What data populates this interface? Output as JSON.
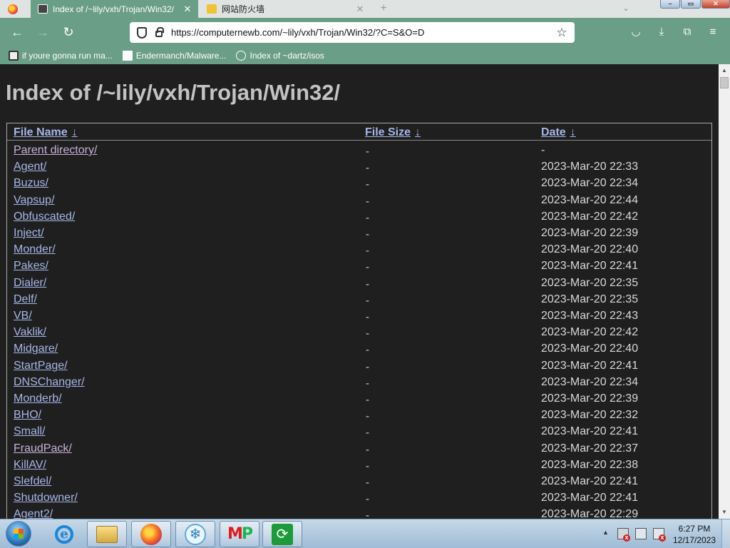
{
  "browser": {
    "tabs": [
      {
        "title": "Index of /~lily/vxh/Trojan/Win32/",
        "active": true,
        "close": "✕"
      },
      {
        "title": "网站防火墙",
        "active": false,
        "close": "✕"
      }
    ],
    "new_tab": "+",
    "tab_list": "⌄",
    "window_buttons": {
      "minimize": "–",
      "maximize": "▭",
      "close": "✕"
    },
    "nav": {
      "back": "←",
      "forward": "→",
      "reload": "↻"
    },
    "url": "https://computernewb.com/~lily/vxh/Trojan/Win32/?C=S&O=D",
    "star": "☆",
    "tools": {
      "pocket": "◡",
      "downloads": "⤓",
      "extensions": "⧉",
      "menu": "≡"
    },
    "bookmarks": [
      {
        "label": "if youre gonna run ma...",
        "icon": "shield"
      },
      {
        "label": "Endermanch/Malware...",
        "icon": "file"
      },
      {
        "label": "Index of ~dartz/isos",
        "icon": "globe"
      }
    ]
  },
  "page": {
    "title": "Index of /~lily/vxh/Trojan/Win32/",
    "columns": {
      "name": "File Name",
      "size": "File Size",
      "date": "Date",
      "sort_marker": "↓"
    },
    "rows": [
      {
        "name": "Parent directory/",
        "size": "-",
        "date": "-",
        "visited": true
      },
      {
        "name": "Agent/",
        "size": "-",
        "date": "2023-Mar-20 22:33",
        "visited": false
      },
      {
        "name": "Buzus/",
        "size": "-",
        "date": "2023-Mar-20 22:34",
        "visited": false
      },
      {
        "name": "Vapsup/",
        "size": "-",
        "date": "2023-Mar-20 22:44",
        "visited": false
      },
      {
        "name": "Obfuscated/",
        "size": "-",
        "date": "2023-Mar-20 22:42",
        "visited": false
      },
      {
        "name": "Inject/",
        "size": "-",
        "date": "2023-Mar-20 22:39",
        "visited": false
      },
      {
        "name": "Monder/",
        "size": "-",
        "date": "2023-Mar-20 22:40",
        "visited": false
      },
      {
        "name": "Pakes/",
        "size": "-",
        "date": "2023-Mar-20 22:41",
        "visited": false
      },
      {
        "name": "Dialer/",
        "size": "-",
        "date": "2023-Mar-20 22:35",
        "visited": false
      },
      {
        "name": "Delf/",
        "size": "-",
        "date": "2023-Mar-20 22:35",
        "visited": false
      },
      {
        "name": "VB/",
        "size": "-",
        "date": "2023-Mar-20 22:43",
        "visited": false
      },
      {
        "name": "Vaklik/",
        "size": "-",
        "date": "2023-Mar-20 22:42",
        "visited": false
      },
      {
        "name": "Midgare/",
        "size": "-",
        "date": "2023-Mar-20 22:40",
        "visited": false
      },
      {
        "name": "StartPage/",
        "size": "-",
        "date": "2023-Mar-20 22:41",
        "visited": false
      },
      {
        "name": "DNSChanger/",
        "size": "-",
        "date": "2023-Mar-20 22:34",
        "visited": false
      },
      {
        "name": "Monderb/",
        "size": "-",
        "date": "2023-Mar-20 22:39",
        "visited": false
      },
      {
        "name": "BHO/",
        "size": "-",
        "date": "2023-Mar-20 22:32",
        "visited": false
      },
      {
        "name": "Small/",
        "size": "-",
        "date": "2023-Mar-20 22:41",
        "visited": false
      },
      {
        "name": "FraudPack/",
        "size": "-",
        "date": "2023-Mar-20 22:37",
        "visited": true
      },
      {
        "name": "KillAV/",
        "size": "-",
        "date": "2023-Mar-20 22:38",
        "visited": false
      },
      {
        "name": "Slefdel/",
        "size": "-",
        "date": "2023-Mar-20 22:41",
        "visited": false
      },
      {
        "name": "Shutdowner/",
        "size": "-",
        "date": "2023-Mar-20 22:41",
        "visited": false
      },
      {
        "name": "Agent2/",
        "size": "-",
        "date": "2023-Mar-20 22:29",
        "visited": false
      }
    ]
  },
  "scrollbar": {
    "up": "▲",
    "down": "▼"
  },
  "taskbar": {
    "clock_time": "6:27 PM",
    "clock_date": "12/17/2023",
    "tray_up": "▲",
    "apps": [
      "internet-explorer",
      "windows-explorer",
      "firefox",
      "snow-app",
      "mp-app",
      "sync-app"
    ],
    "ie_glyph": "e",
    "snow_glyph": "❄",
    "mp_m": "M",
    "mp_p": "P",
    "sync_glyph": "⟳"
  },
  "colors": {
    "chrome": "#6b9e86",
    "page_bg": "#1f1f1f",
    "link": "#a6b6e8",
    "visited_link": "#c7b0d8"
  }
}
